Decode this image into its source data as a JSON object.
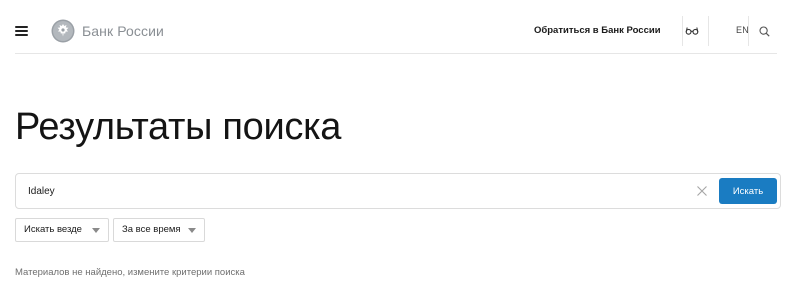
{
  "header": {
    "brand": "Банк России",
    "contact_link": "Обратиться в Банк России",
    "lang": "EN",
    "icons": {
      "menu": "hamburger-menu-icon",
      "logo": "double-headed-eagle-emblem",
      "accessibility": "glasses-icon",
      "search": "search-icon"
    }
  },
  "main": {
    "title": "Результаты поиска",
    "search": {
      "value": "Idaley",
      "button_label": "Искать",
      "clear_icon": "close-icon"
    },
    "filters": [
      {
        "label": "Искать везде"
      },
      {
        "label": "За все время"
      }
    ],
    "message": "Материалов не найдено, измените критерии поиска"
  },
  "colors": {
    "accent": "#1a7cc2",
    "muted_text": "#6f6f6f",
    "brand_text": "#8a8f94"
  }
}
